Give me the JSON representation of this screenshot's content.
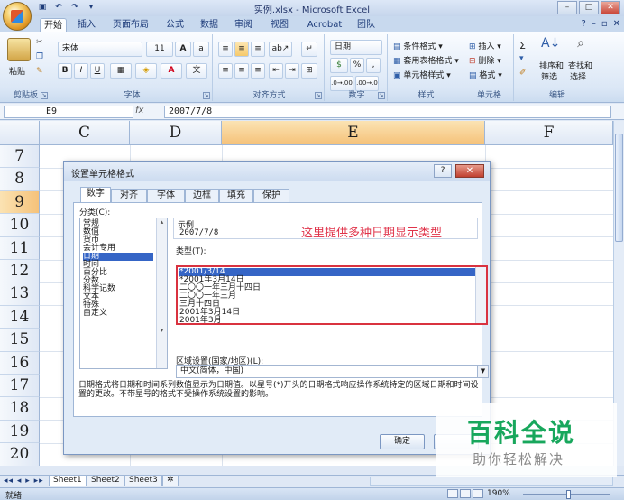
{
  "window": {
    "title": "实例.xlsx - Microsoft Excel"
  },
  "ribbon": {
    "tabs": [
      "开始",
      "插入",
      "页面布局",
      "公式",
      "数据",
      "审阅",
      "视图",
      "Acrobat",
      "团队"
    ],
    "active_tab": "开始",
    "clipboard": {
      "paste": "粘贴",
      "label": "剪贴板"
    },
    "font": {
      "name": "宋体",
      "size": "11",
      "bold": "B",
      "italic": "I",
      "underline": "U",
      "label": "字体"
    },
    "alignment": {
      "label": "对齐方式"
    },
    "number": {
      "format": "日期",
      "percent": "%",
      "comma": ",",
      "label": "数字"
    },
    "styles": {
      "conditional": "条件格式",
      "table": "套用表格格式",
      "cell": "单元格样式",
      "label": "样式"
    },
    "cells": {
      "insert": "插入",
      "delete": "删除",
      "format": "格式",
      "label": "单元格"
    },
    "editing": {
      "sigma": "Σ",
      "sort": "排序和",
      "sort2": "筛选",
      "find": "查找和",
      "find2": "选择",
      "label": "编辑"
    }
  },
  "formula_bar": {
    "cell_ref": "E9",
    "fx": "fx",
    "value": "2007/7/8"
  },
  "grid": {
    "columns": [
      "C",
      "D",
      "E",
      "F"
    ],
    "selected_column": "E",
    "rows": [
      "7",
      "8",
      "9",
      "10",
      "11",
      "12",
      "13",
      "14",
      "15",
      "16",
      "17",
      "18",
      "19",
      "20"
    ],
    "selected_row": "9"
  },
  "dialog": {
    "title": "设置单元格格式",
    "help": "?",
    "close": "✕",
    "tabs": [
      "数字",
      "对齐",
      "字体",
      "边框",
      "填充",
      "保护"
    ],
    "active_tab": "数字",
    "category_label": "分类(C):",
    "categories": [
      "常规",
      "数值",
      "货币",
      "会计专用",
      "日期",
      "时间",
      "百分比",
      "分数",
      "科学记数",
      "文本",
      "特殊",
      "自定义"
    ],
    "selected_category": "日期",
    "sample_label": "示例",
    "sample_value": "2007/7/8",
    "type_label": "类型(T):",
    "types": [
      "*2001/3/14",
      "*2001年3月14日",
      "二〇〇一年三月十四日",
      "二〇〇一年三月",
      "三月十四日",
      "2001年3月14日",
      "2001年3月"
    ],
    "selected_type": "*2001/3/14",
    "locale_label": "区域设置(国家/地区)(L):",
    "locale_value": "中文(简体，中国)",
    "description": "日期格式将日期和时间系列数值显示为日期值。以星号(*)开头的日期格式响应操作系统特定的区域日期和时间设置的更改。不带星号的格式不受操作系统设置的影响。",
    "ok": "确定",
    "annotation": "这里提供多种日期显示类型"
  },
  "sheets": [
    "Sheet1",
    "Sheet2",
    "Sheet3"
  ],
  "status": {
    "ready": "就绪",
    "zoom": "190%"
  },
  "watermark": {
    "title": "百科全说",
    "subtitle": "助你轻松解决"
  },
  "colors": {
    "accent": "#3565c6",
    "annotation": "#e0334a",
    "watermark": "#18a75c"
  }
}
